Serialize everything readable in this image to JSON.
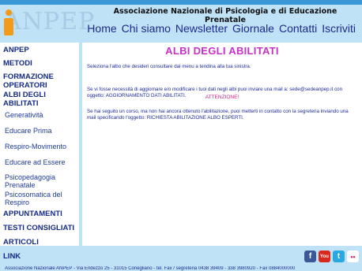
{
  "header": {
    "logo_text": "ANPEP",
    "org_name": "Associazione Nazionale di Psicologia e di Educazione Prenatale"
  },
  "topnav": [
    "Home",
    "Chi siamo",
    "Newsletter",
    "Giornale",
    "Contatti",
    "Iscriviti"
  ],
  "sidebar": {
    "items": [
      {
        "label": "ANPEP"
      },
      {
        "label": "METODI"
      },
      {
        "label": "FORMAZIONE OPERATORI"
      },
      {
        "label": "ALBI DEGLI ABILITATI"
      },
      {
        "label": "Generatività"
      },
      {
        "label": "Educare Prima"
      },
      {
        "label": "Respiro-Movimento"
      },
      {
        "label": "Educare ad Essere"
      },
      {
        "label": "Psicopedagogia Prenatale"
      },
      {
        "label": "Psicosomatica del Respiro"
      },
      {
        "label": "APPUNTAMENTI"
      },
      {
        "label": "TESTI CONSIGLIATI"
      },
      {
        "label": "ARTICOLI"
      },
      {
        "label": "LINK"
      }
    ]
  },
  "main": {
    "title": "ALBI DEGLI ABILITATI",
    "intro": "Seleziona l'albo che desideri consultare dal menu a tendina alla tua sinistra.",
    "attention": "ATTENZIONE!",
    "para1": "Se vi fosse necessità di aggiornare e/o modificare i tuoi dati negli albi puoi inviare una mail a: sede@sedeanpep.it con oggetto: AGGIORNAMENTO DATI ABILITATI.",
    "para2": "Se hai seguito un corso, ma non hai ancora ottenuto l'abilitazione, puoi metterti in contatto con la segreteria inviando una mail specificando l'oggetto: RICHIESTA ABILITAZIONE ALBO ESPERTI."
  },
  "social": {
    "facebook": "f",
    "youtube": "You",
    "twitter": "t",
    "flickr": "••"
  },
  "footer": {
    "text": "Associazione Nazionale ANPEP - Via Endezzo 25 - 31015 Conegliano - tel. Fax / segreteria 0438 39409 - 338 3980920 - Fax 0884000000"
  },
  "colors": {
    "background": "#bfe2f7",
    "nav_text": "#1a2a8a",
    "title": "#c830c8",
    "attention": "#d0208a",
    "logo_orange": "#f39a1b"
  }
}
